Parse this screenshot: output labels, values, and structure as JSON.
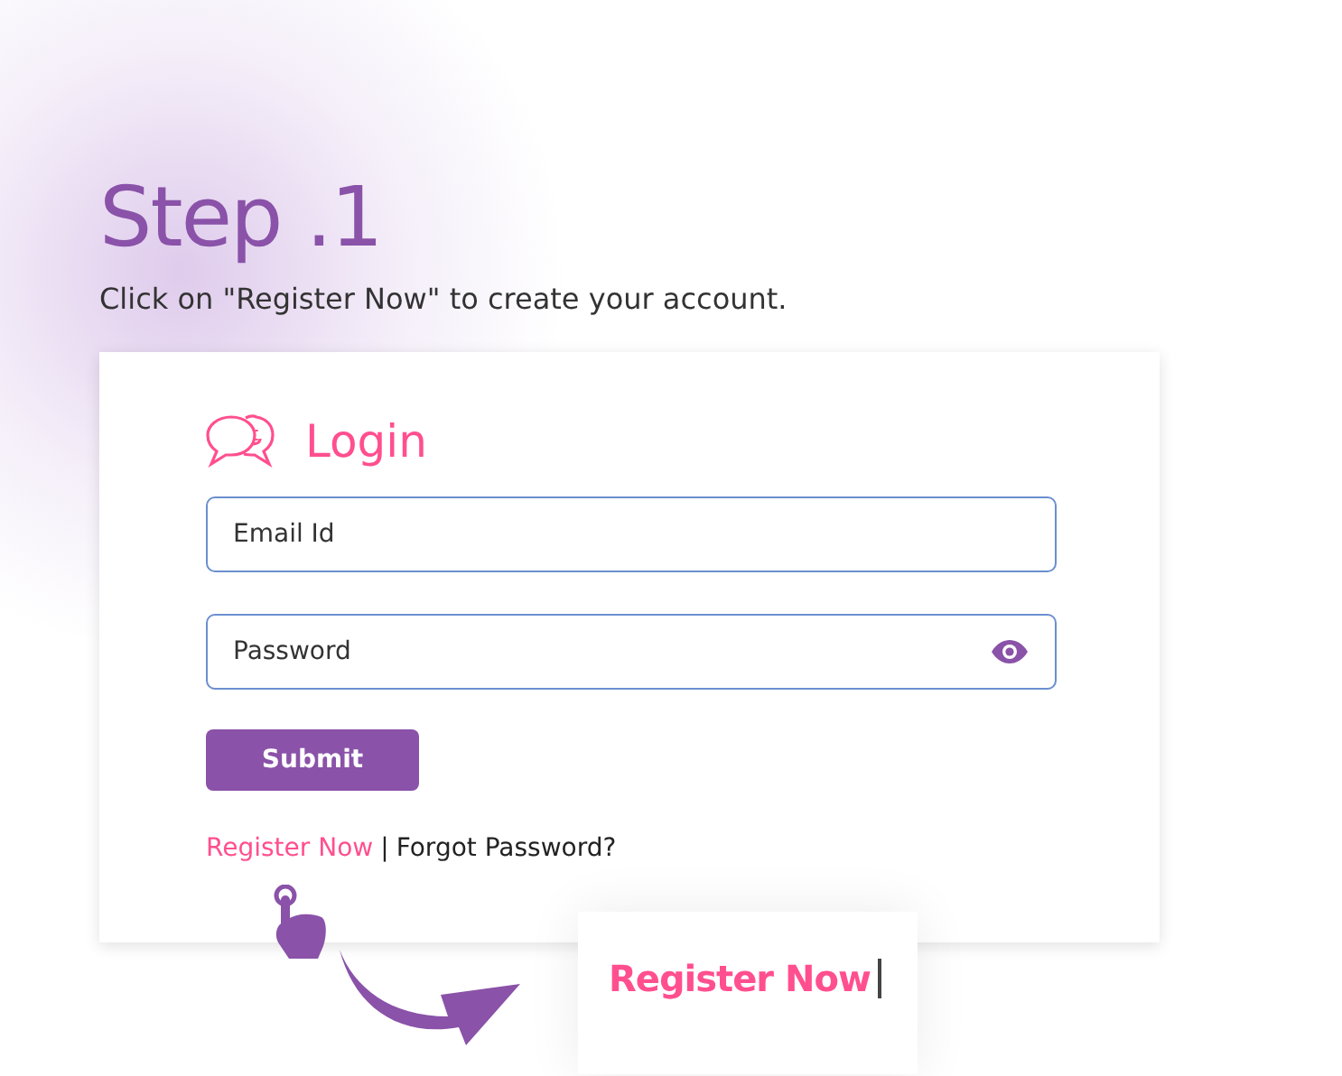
{
  "step_title": "Step .1",
  "instruction": "Click on \"Register Now\" to create your account.",
  "login": {
    "title": "Login",
    "fields": [
      {
        "kind": "text",
        "placeholder": "Email Id"
      },
      {
        "kind": "password",
        "placeholder": "Password"
      }
    ],
    "submit": "Submit",
    "links": {
      "register": "Register Now",
      "separator": "|",
      "forgot": "Forgot Password?"
    }
  },
  "callout": {
    "text": "Register Now"
  }
}
